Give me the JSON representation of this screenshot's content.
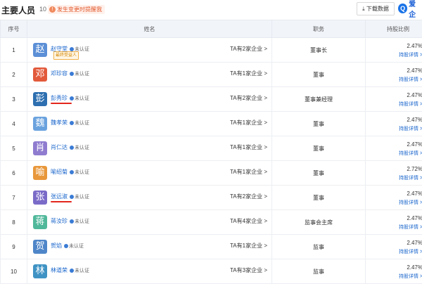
{
  "header": {
    "title": "主要人员",
    "count": "10",
    "alert_text": "发生变更时提醒我",
    "download_label": "下载数据",
    "brand_text": "爱企"
  },
  "columns": {
    "no": "序号",
    "name": "姓名",
    "position": "职务",
    "share": "持股比例"
  },
  "rows": [
    {
      "no": "1",
      "surname": "赵",
      "name": "赵守堂",
      "cert": "未认证",
      "tag": "最终受益人",
      "companies": "TA有2家企业 >",
      "position": "董事长",
      "share": "2.47%",
      "detail": "持股详情 >",
      "avatar_color": "#5b8fd6"
    },
    {
      "no": "2",
      "surname": "邓",
      "name": "邓珍容",
      "cert": "未认证",
      "tag": "",
      "companies": "TA有1家企业 >",
      "position": "董事",
      "share": "2.47%",
      "detail": "持股详情 >",
      "avatar_color": "#e25a3b"
    },
    {
      "no": "3",
      "surname": "彭",
      "name": "彭秀珍",
      "cert": "未认证",
      "tag": "",
      "companies": "TA有2家企业 >",
      "position": "董事兼经理",
      "share": "2.47%",
      "detail": "持股详情 >",
      "avatar_color": "#2d6fb0"
    },
    {
      "no": "4",
      "surname": "魏",
      "name": "魏孝荣",
      "cert": "未认证",
      "tag": "",
      "companies": "TA有1家企业 >",
      "position": "董事",
      "share": "2.47%",
      "detail": "持股详情 >",
      "avatar_color": "#6aa2de"
    },
    {
      "no": "5",
      "surname": "肖",
      "name": "肖仁达",
      "cert": "未认证",
      "tag": "",
      "companies": "TA有1家企业 >",
      "position": "董事",
      "share": "2.47%",
      "detail": "持股详情 >",
      "avatar_color": "#8f7ccf"
    },
    {
      "no": "6",
      "surname": "喻",
      "name": "喻绍菊",
      "cert": "未认证",
      "tag": "",
      "companies": "TA有1家企业 >",
      "position": "董事",
      "share": "2.72%",
      "detail": "持股详情 >",
      "avatar_color": "#e8973a"
    },
    {
      "no": "7",
      "surname": "张",
      "name": "张远淑",
      "cert": "未认证",
      "tag": "",
      "companies": "TA有2家企业 >",
      "position": "董事",
      "share": "2.47%",
      "detail": "持股详情 >",
      "avatar_color": "#7b6bc8"
    },
    {
      "no": "8",
      "surname": "蒋",
      "name": "蒋汝珍",
      "cert": "未认证",
      "tag": "",
      "companies": "TA有4家企业 >",
      "position": "监事会主席",
      "share": "2.47%",
      "detail": "持股详情 >",
      "avatar_color": "#50b89a"
    },
    {
      "no": "9",
      "surname": "贺",
      "name": "贺焰",
      "cert": "未认证",
      "tag": "",
      "companies": "TA有1家企业 >",
      "position": "监事",
      "share": "2.47%",
      "detail": "持股详情 >",
      "avatar_color": "#4f86c9"
    },
    {
      "no": "10",
      "surname": "林",
      "name": "林道荣",
      "cert": "未认证",
      "tag": "",
      "companies": "TA有3家企业 >",
      "position": "监事",
      "share": "2.47%",
      "detail": "持股详情 >",
      "avatar_color": "#3f93c4"
    }
  ]
}
